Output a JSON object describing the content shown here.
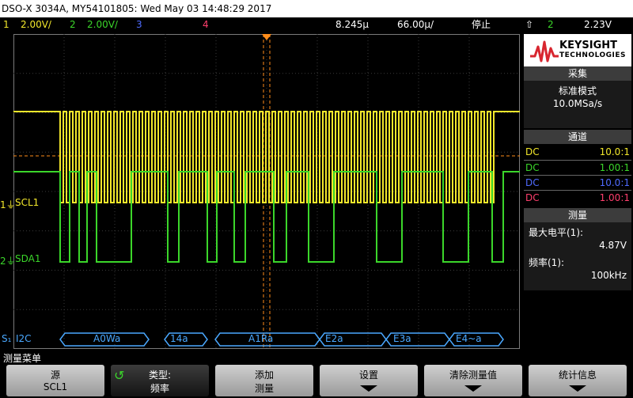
{
  "title_bar": {
    "text": "DSO-X 3034A, MY54101805: Wed May 03 14:48:29 2017"
  },
  "channel_bar": {
    "ch1_num": "1",
    "ch1_scale": "2.00V/",
    "ch2_num": "2",
    "ch2_scale": "2.00V/",
    "ch3_num": "3",
    "ch4_num": "4",
    "time_offset": "8.245µ",
    "time_scale": "66.00µ/",
    "run_state": "停止",
    "trigger_channel": "2",
    "trigger_level": "2.23V",
    "colors": {
      "ch1": "#f2e72b",
      "ch2": "#3bd62a",
      "ch3": "#4f6bff",
      "ch4": "#ff3f6d"
    }
  },
  "brand": {
    "line1": "KEYSIGHT",
    "line2": "TECHNOLOGIES"
  },
  "acquisition": {
    "title": "采集",
    "mode": "标准模式",
    "rate": "10.0MSa/s"
  },
  "channels_panel": {
    "title": "通道",
    "rows": [
      {
        "coupling": "DC",
        "ratio": "10.0:1",
        "color": "#f2e72b"
      },
      {
        "coupling": "DC",
        "ratio": "1.00:1",
        "color": "#3bd62a"
      },
      {
        "coupling": "DC",
        "ratio": "10.0:1",
        "color": "#4f6bff"
      },
      {
        "coupling": "DC",
        "ratio": "1.00:1",
        "color": "#ff3f6d"
      }
    ]
  },
  "measure_panel": {
    "title": "测量",
    "m1_label": "最大电平(1):",
    "m1_value": "4.87V",
    "m2_label": "频率(1):",
    "m2_value": "100kHz"
  },
  "traces": {
    "ch1_label": "SCL1",
    "ch1_marker": "1",
    "ch2_label": "SDA1",
    "ch2_marker": "2"
  },
  "decode": {
    "bus_marker": "S₁",
    "bus_name": "I2C",
    "packets": [
      "A0Wa",
      "14a",
      "A1Ra",
      "E2a",
      "E3a",
      "E4~a"
    ]
  },
  "menu": {
    "title": "测量菜单"
  },
  "softkeys": {
    "source_label": "源",
    "source_value": "SCL1",
    "type_label": "类型:",
    "type_value": "频率",
    "add_label": "添加",
    "add_sub": "测量",
    "settings_label": "设置",
    "clear_label": "清除测量值",
    "stats_label": "统计信息"
  }
}
